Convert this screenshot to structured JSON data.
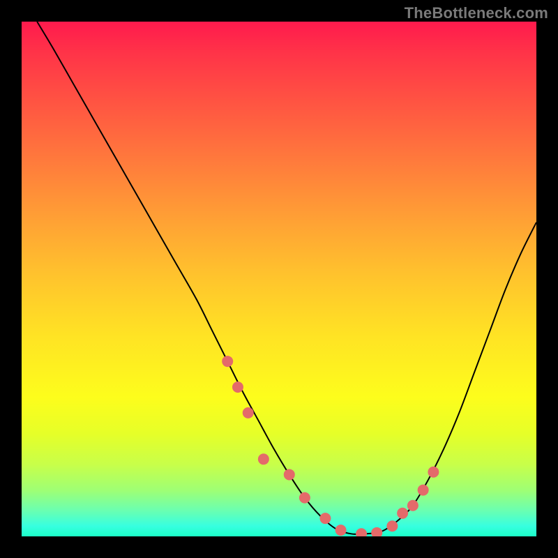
{
  "attribution": "TheBottleneck.com",
  "colors": {
    "background": "#000000",
    "gradient_top": "#ff1a4d",
    "gradient_bottom": "#1bffc8",
    "curve": "#000000",
    "marker": "#e46a6a"
  },
  "chart_data": {
    "type": "line",
    "title": "",
    "xlabel": "",
    "ylabel": "",
    "xlim": [
      0,
      100
    ],
    "ylim": [
      0,
      100
    ],
    "grid": false,
    "series": [
      {
        "name": "bottleneck-curve",
        "x": [
          3,
          6,
          10,
          14,
          18,
          22,
          26,
          30,
          34,
          37,
          40,
          43,
          46,
          49,
          52,
          55,
          58,
          61,
          64,
          67,
          70,
          73,
          76,
          79,
          82,
          85,
          88,
          91,
          94,
          97,
          100
        ],
        "values": [
          100,
          95,
          88,
          81,
          74,
          67,
          60,
          53,
          46,
          40,
          34,
          28,
          22.5,
          17,
          12,
          7.5,
          4,
          1.5,
          0.5,
          0.5,
          1,
          3,
          6,
          11,
          17,
          24,
          32,
          40,
          48,
          55,
          61
        ]
      }
    ],
    "markers": {
      "name": "highlighted-points",
      "x": [
        40,
        42,
        44,
        47,
        52,
        55,
        59,
        62,
        66,
        69,
        72,
        74,
        76,
        78,
        80
      ],
      "values": [
        34,
        29,
        24,
        15,
        12,
        7.5,
        3.5,
        1.2,
        0.5,
        0.7,
        2,
        4.5,
        6,
        9,
        12.5
      ]
    }
  }
}
